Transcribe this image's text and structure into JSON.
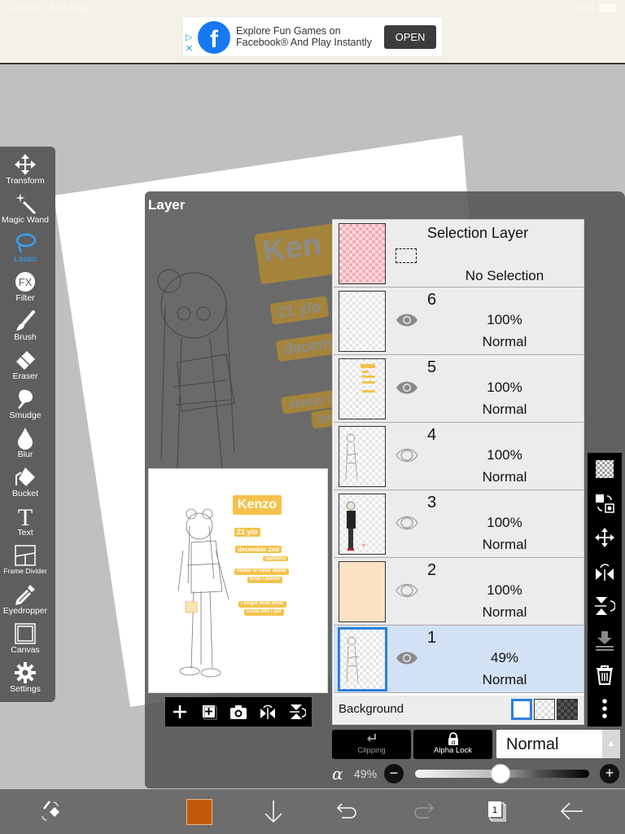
{
  "status_bar": {
    "time": "1:49 PM",
    "date": "Sun May 17",
    "battery": "65%"
  },
  "ad": {
    "line1": "Explore Fun Games on",
    "line2": "Facebook® And Play Instantly",
    "cta": "OPEN",
    "brand_color": "#1877f2"
  },
  "toolbar": {
    "active": "Lasso",
    "accent_color": "#38a0f5",
    "tools": [
      {
        "label": "Transform",
        "icon": "move-arrows-icon"
      },
      {
        "label": "Magic Wand",
        "icon": "magic-wand-icon"
      },
      {
        "label": "Lasso",
        "icon": "lasso-icon"
      },
      {
        "label": "Filter",
        "icon": "fx-icon"
      },
      {
        "label": "Brush",
        "icon": "brush-icon"
      },
      {
        "label": "Eraser",
        "icon": "eraser-icon"
      },
      {
        "label": "Smudge",
        "icon": "smudge-icon"
      },
      {
        "label": "Blur",
        "icon": "blur-drop-icon"
      },
      {
        "label": "Bucket",
        "icon": "bucket-icon"
      },
      {
        "label": "Text",
        "icon": "text-icon"
      },
      {
        "label": "Frame Divider",
        "icon": "frame-divider-icon"
      },
      {
        "label": "Eyedropper",
        "icon": "eyedropper-icon"
      },
      {
        "label": "Canvas",
        "icon": "canvas-icon"
      },
      {
        "label": "Settings",
        "icon": "gear-icon"
      }
    ]
  },
  "layer_panel": {
    "title": "Layer",
    "background_art_tags": [
      "Ken",
      "21 y/o",
      "decem",
      "skater o",
      "bru"
    ],
    "preview": {
      "name_tag": "Kenzo",
      "age_tag": "21 y/o",
      "birthday_tag": "december 2nd",
      "sign_tag": "sagittarius",
      "hobby_tag_1": "skater or roller skater",
      "hobby_tag_2": "bruh i dunno",
      "note_tag_1": "i forgot what other",
      "note_tag_2": "usual info i put"
    },
    "selection_layer": {
      "title": "Selection Layer",
      "status": "No Selection"
    },
    "layers": [
      {
        "name": "6",
        "opacity": "100%",
        "mode": "Normal",
        "visible": true,
        "selected": false
      },
      {
        "name": "5",
        "opacity": "100%",
        "mode": "Normal",
        "visible": true,
        "selected": false
      },
      {
        "name": "4",
        "opacity": "100%",
        "mode": "Normal",
        "visible": false,
        "selected": false
      },
      {
        "name": "3",
        "opacity": "100%",
        "mode": "Normal",
        "visible": false,
        "selected": false
      },
      {
        "name": "2",
        "opacity": "100%",
        "mode": "Normal",
        "visible": false,
        "selected": false
      },
      {
        "name": "1",
        "opacity": "49%",
        "mode": "Normal",
        "visible": true,
        "selected": true
      }
    ],
    "background": {
      "label": "Background",
      "selected_option": "white"
    },
    "clipping_label": "Clipping",
    "alpha_lock_label": "Alpha Lock",
    "blend_mode": "Normal",
    "alpha_symbol": "α",
    "opacity_label": "49%",
    "opacity_value": 0.49,
    "selection_color": "#2f7fdb"
  },
  "bottom_bar": {
    "current_color": "#c05a0a",
    "page_count": "1"
  }
}
